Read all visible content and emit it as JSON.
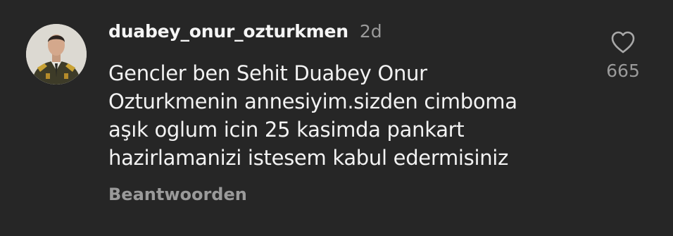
{
  "comment": {
    "username": "duabey_onur_ozturkmen",
    "time": "2d",
    "text_lines": [
      "Gencler ben Sehit Duabey Onur",
      "Ozturkmenin annesiyim.sizden cimboma",
      "aşık oglum icin 25 kasimda pankart",
      "hazirlamanizi istesem kabul edermisiniz"
    ],
    "reply_label": "Beantwoorden",
    "like_count": "665",
    "icons": {
      "like": "heart-outline-icon",
      "avatar": "profile-photo-soldier"
    },
    "colors": {
      "background": "#262626",
      "text": "#f2f2f2",
      "secondary": "#9a9a9a"
    }
  }
}
